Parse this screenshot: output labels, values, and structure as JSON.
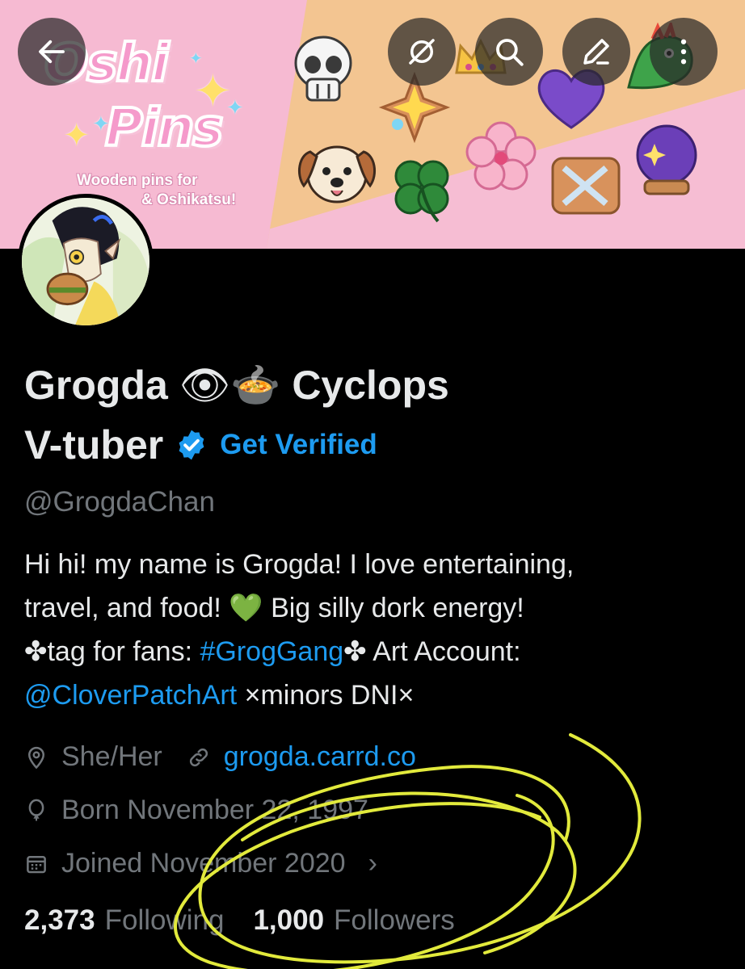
{
  "banner": {
    "logo_line1": "Oshi",
    "logo_line2": "Pins",
    "tagline_line1": "Wooden pins for",
    "tagline_line2": "& Oshikatsu!",
    "stickers": [
      "skull-icon",
      "crown-icon",
      "sparkle-cookie-icon",
      "purple-heart-icon",
      "dragon-icon",
      "dog-icon",
      "clover-icon",
      "cherry-blossom-icon",
      "crossed-swords-icon",
      "crystal-ball-icon"
    ]
  },
  "toolbar": {
    "back_icon": "back-arrow-icon",
    "mute_icon": "mute-icon",
    "search_icon": "search-icon",
    "edit_icon": "edit-icon"
  },
  "profile": {
    "name_part1": "Grogda ",
    "name_emojis": "👁🍲",
    "name_part2": " Cyclops",
    "name_line2": "V-tuber",
    "get_verified": "Get Verified",
    "handle": "@GrogdaChan",
    "bio_line1": "Hi hi! my name is Grogda! I love entertaining,",
    "bio_line2_a": "travel, and food! ",
    "bio_heart": "💚",
    "bio_line2_b": " Big silly dork energy!",
    "bio_line3_a": "✤tag for fans: ",
    "bio_hashtag": "#GrogGang",
    "bio_line3_b": "✤ Art Account:",
    "bio_mention": "@CloverPatchArt",
    "bio_line4_b": " ×minors DNI×",
    "pronouns": "She/Her",
    "website": "grogda.carrd.co",
    "born": "Born November 22, 1997",
    "joined": "Joined November 2020",
    "following_count": "2,373",
    "following_label": "Following",
    "followers_count": "1,000",
    "followers_label": "Followers"
  },
  "colors": {
    "accent": "#1d9bf0",
    "muted": "#71767b",
    "text": "#e7e9ea",
    "annotation": "#e2ea3c"
  }
}
